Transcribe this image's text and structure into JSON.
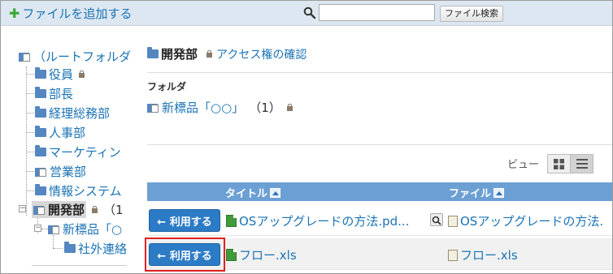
{
  "topbar": {
    "add_file": "ファイルを追加する",
    "search_placeholder": "",
    "search_button": "ファイル検索"
  },
  "tree": {
    "root": "（ルートフォルダ）",
    "items": [
      {
        "label": "役員"
      },
      {
        "label": "部長"
      },
      {
        "label": "経理総務部"
      },
      {
        "label": "人事部"
      },
      {
        "label": "マーケティン"
      },
      {
        "label": "営業部"
      },
      {
        "label": "情報システム"
      },
      {
        "label": "開発部",
        "count": "（1"
      },
      {
        "label": "新標品「○"
      },
      {
        "label": "社外連絡"
      }
    ]
  },
  "main": {
    "folder_title": "開発部",
    "access_link": "アクセス権の確認",
    "section_label": "フォルダ",
    "subfolder": {
      "name": "新標品「○○」",
      "count": "（1）"
    },
    "view_label": "ビュー",
    "columns": {
      "title": "タイトル",
      "file": "ファイル"
    },
    "use_button": "← 利用する",
    "rows": [
      {
        "title": "OSアップグレードの方法.pd...",
        "file": "OSアップグレードの方法."
      },
      {
        "title": "フロー.xls",
        "file": "フロー.xls"
      }
    ]
  },
  "colors": {
    "accent": "#2c7bc6",
    "header": "#6ca0d4",
    "highlight": "#e02020"
  }
}
